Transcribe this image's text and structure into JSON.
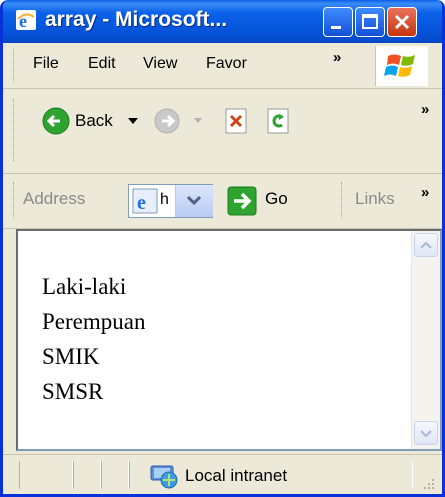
{
  "window": {
    "title": "array - Microsoft...",
    "buttons": {
      "minimize": "minimize",
      "maximize": "maximize",
      "close": "close"
    }
  },
  "menu": {
    "items": [
      "File",
      "Edit",
      "View",
      "Favor"
    ],
    "overflow": "»"
  },
  "toolbar": {
    "back_label": "Back",
    "overflow": "»"
  },
  "address": {
    "label": "Address",
    "value": "h",
    "go_label": "Go",
    "links_label": "Links",
    "overflow": "»"
  },
  "content": {
    "lines": [
      "Laki-laki",
      "Perempuan",
      "SMIK",
      "SMSR"
    ]
  },
  "status": {
    "zone": "Local intranet"
  },
  "colors": {
    "titlebar": "#0553d8",
    "chrome": "#ece9d8",
    "go_green": "#2fa32f",
    "close_red": "#d2401c"
  }
}
